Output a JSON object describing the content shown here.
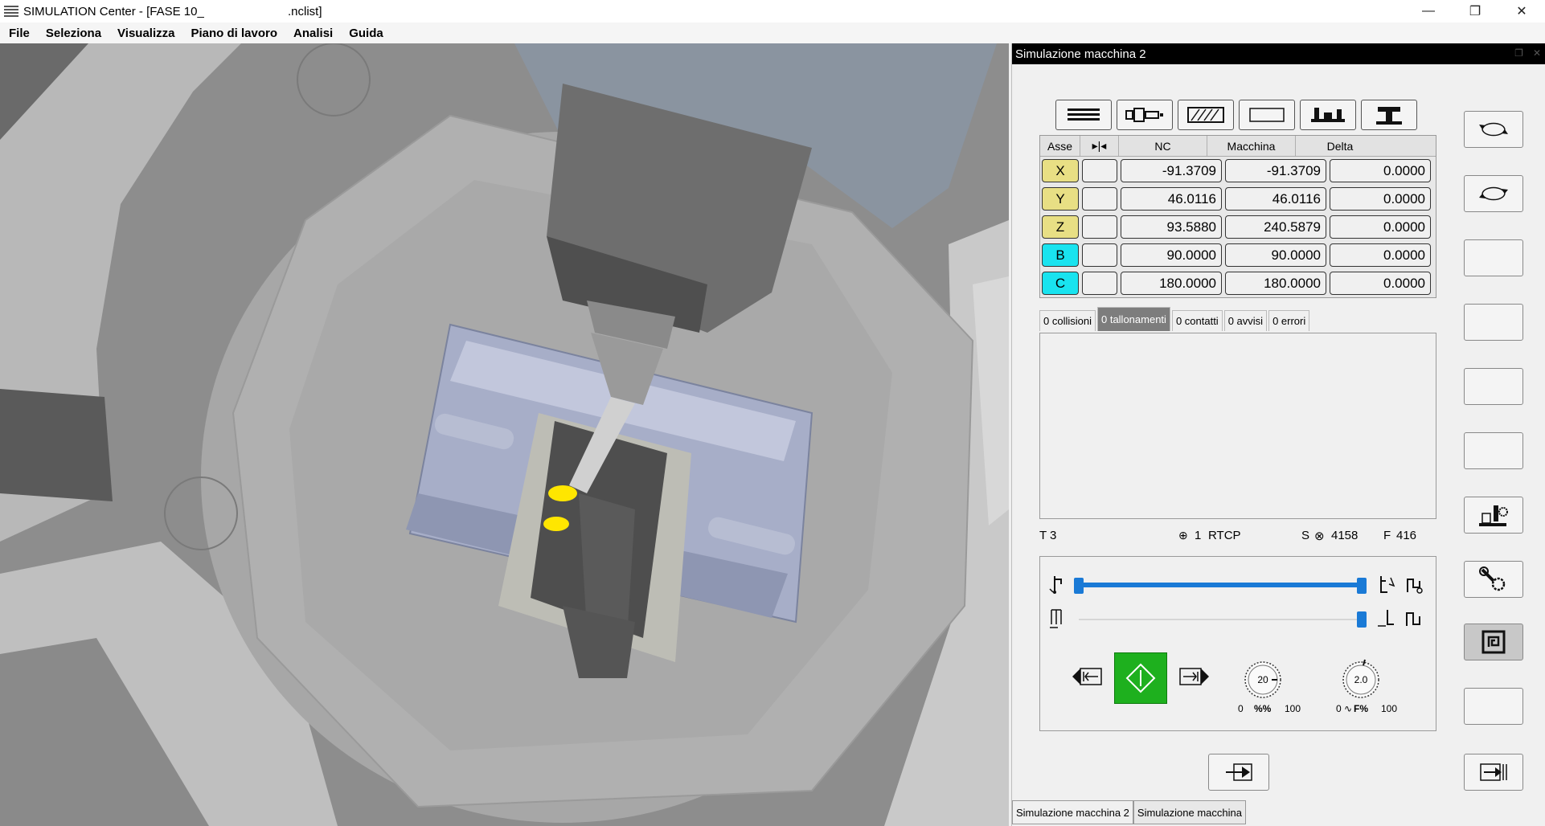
{
  "window": {
    "title": "SIMULATION Center - [FASE 10_                         .nclist]",
    "minimize": "—",
    "restore": "❐",
    "close": "✕"
  },
  "menu": [
    "File",
    "Seleziona",
    "Visualizza",
    "Piano di lavoro",
    "Analisi",
    "Guida"
  ],
  "panel": {
    "title": "Simulazione macchina 2",
    "table": {
      "headers": {
        "axis": "Asse",
        "nc": "NC",
        "machine": "Macchina",
        "delta": "Delta"
      },
      "rows": [
        {
          "axis": "X",
          "nc": "-91.3709",
          "machine": "-91.3709",
          "delta": "0.0000",
          "color": "#e8df84"
        },
        {
          "axis": "Y",
          "nc": "46.0116",
          "machine": "46.0116",
          "delta": "0.0000",
          "color": "#e8df84"
        },
        {
          "axis": "Z",
          "nc": "93.5880",
          "machine": "240.5879",
          "delta": "0.0000",
          "color": "#e8df84"
        },
        {
          "axis": "B",
          "nc": "90.0000",
          "machine": "90.0000",
          "delta": "0.0000",
          "color": "#19e3ef"
        },
        {
          "axis": "C",
          "nc": "180.0000",
          "machine": "180.0000",
          "delta": "0.0000",
          "color": "#19e3ef"
        }
      ]
    },
    "tabs": [
      "0 collisioni",
      "0 tallonamenti",
      "0 contatti",
      "0 avvisi",
      "0 errori"
    ],
    "active_tab": 1,
    "status": {
      "tool": "T 3",
      "rtcp_num": "1",
      "rtcp": "RTCP",
      "spindle_label": "S",
      "spindle": "4158",
      "feed_label": "F",
      "feed": "416"
    },
    "dials": {
      "speed_value": "20",
      "speed_min": "0",
      "speed_max": "100",
      "speed_unit": "%%",
      "feed_value": "2.0",
      "feed_min": "0",
      "feed_max": "100",
      "feed_unit": "F%"
    },
    "slider_progress": 1.0
  },
  "bottom_tabs": [
    "Simulazione macchina 2",
    "Simulazione macchina"
  ],
  "colors": {
    "axis_linear": "#e8df84",
    "axis_rotary": "#19e3ef",
    "play_green": "#1eb01e",
    "slider_blue": "#1a7ad6"
  }
}
